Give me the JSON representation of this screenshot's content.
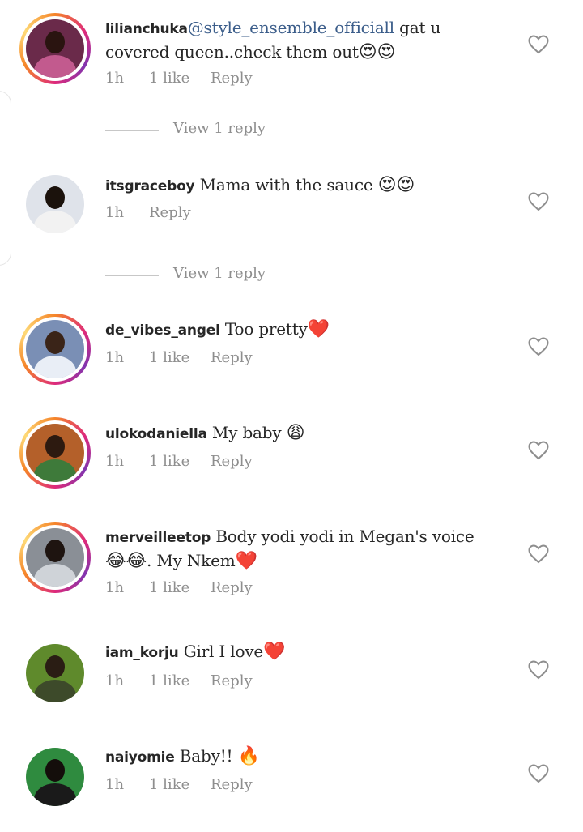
{
  "comments": [
    {
      "username": "lilianchuka",
      "mention": "@style_ensemble_officiall",
      "text": " gat u covered queen..check them out",
      "emoji": "😍😍",
      "time": "1h",
      "likes": "1 like",
      "reply": "Reply",
      "has_story": true,
      "avatar_color": "#6a2a4a",
      "view_replies": "View 1 reply"
    },
    {
      "username": "itsgraceboy",
      "text": " Mama with the sauce ",
      "emoji": "😍😍",
      "time": "1h",
      "reply": "Reply",
      "has_story": false,
      "avatar_color": "#dfe3ea",
      "view_replies": "View 1 reply"
    },
    {
      "username": "de_vibes_angel",
      "text": " Too pretty",
      "emoji": "❤️",
      "time": "1h",
      "likes": "1 like",
      "reply": "Reply",
      "has_story": true,
      "avatar_color": "#7a8fb5"
    },
    {
      "username": "ulokodaniella",
      "text": " My baby ",
      "emoji": "😩",
      "time": "1h",
      "likes": "1 like",
      "reply": "Reply",
      "has_story": true,
      "avatar_color": "#b4602a"
    },
    {
      "username": "merveilleetop",
      "text": " Body yodi yodi in Megan's voice ",
      "emoji": "😂😂",
      "text2": ". My Nkem",
      "emoji2": "❤️",
      "time": "1h",
      "likes": "1 like",
      "reply": "Reply",
      "has_story": true,
      "avatar_color": "#8a8f96"
    },
    {
      "username": "iam_korju",
      "text": " Girl I love",
      "emoji": "❤️",
      "time": "1h",
      "likes": "1 like",
      "reply": "Reply",
      "has_story": false,
      "avatar_color": "#5f8a2c"
    },
    {
      "username": "naiyomie",
      "text": " Baby!! ",
      "emoji": "🔥",
      "time": "1h",
      "likes": "1 like",
      "reply": "Reply",
      "has_story": false,
      "avatar_color": "#2f8b3f"
    }
  ],
  "icons": {
    "like": "heart-outline-icon"
  },
  "colors": {
    "mention": "#3b5d8a",
    "meta": "#8e8e8e",
    "story_ring_start": "#f58529",
    "story_ring_end": "#dd2a7b"
  }
}
